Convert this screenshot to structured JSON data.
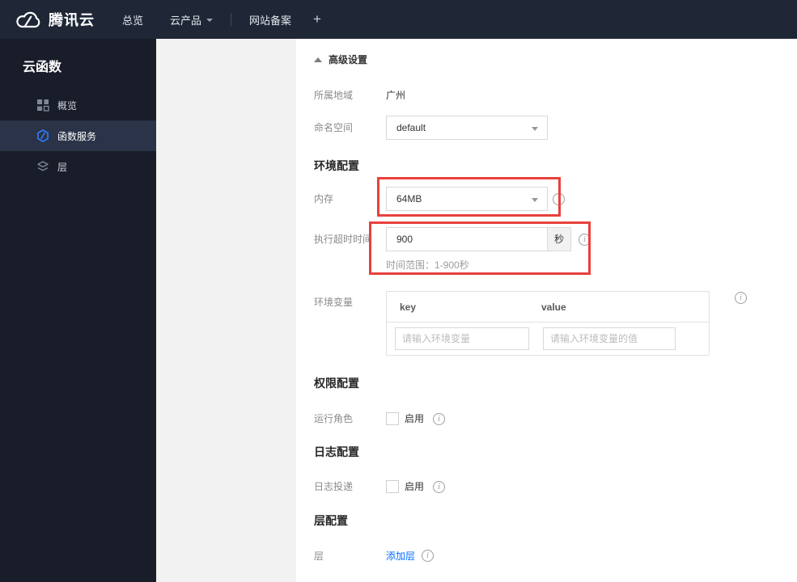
{
  "topnav": {
    "brand": "腾讯云",
    "items": [
      {
        "label": "总览"
      },
      {
        "label": "云产品"
      },
      {
        "label": "网站备案"
      },
      {
        "label": "+"
      }
    ]
  },
  "sidebar": {
    "title": "云函数",
    "items": [
      {
        "label": "概览",
        "icon": "grid-icon",
        "active": false
      },
      {
        "label": "函数服务",
        "icon": "function-hexagon-icon",
        "active": true
      },
      {
        "label": "层",
        "icon": "layers-icon",
        "active": false
      }
    ]
  },
  "content": {
    "advanced_settings_label": "高级设置",
    "region": {
      "label": "所属地域",
      "value": "广州"
    },
    "namespace": {
      "label": "命名空间",
      "value": "default"
    },
    "section_env": "环境配置",
    "memory": {
      "label": "内存",
      "value": "64MB"
    },
    "timeout": {
      "label": "执行超时时间",
      "value": "900",
      "unit": "秒",
      "hint": "时间范围：1-900秒"
    },
    "env_vars": {
      "label": "环境变量",
      "key_header": "key",
      "value_header": "value",
      "key_placeholder": "请输入环境变量",
      "value_placeholder": "请输入环境变量的值"
    },
    "section_perm": "权限配置",
    "run_role": {
      "label": "运行角色",
      "checkbox_label": "启用",
      "checked": false
    },
    "section_log": "日志配置",
    "log_delivery": {
      "label": "日志投递",
      "checkbox_label": "启用",
      "checked": false
    },
    "section_layer": "层配置",
    "layer": {
      "label": "层",
      "add_link": "添加层"
    }
  },
  "colors": {
    "annotation_red": "#e8413d",
    "link_blue": "#006eff",
    "function_icon_blue": "#2f7bff",
    "navbar_bg": "#1f2736",
    "sidebar_bg": "#181d29",
    "sidebar_active_bg": "#2a3347"
  }
}
